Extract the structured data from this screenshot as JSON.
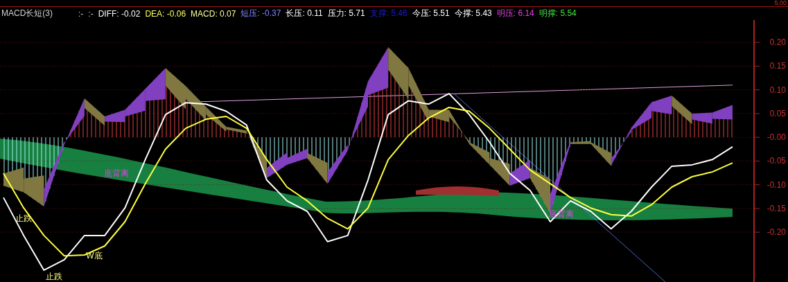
{
  "upper_panel": {
    "axis_label": "5.00"
  },
  "header": {
    "title": "MACD长短(3)",
    "markers": [
      ":-",
      ":-"
    ],
    "items": [
      {
        "label": "DIFF:",
        "value": "-0.02",
        "color": "#ffffff"
      },
      {
        "label": "DEA:",
        "value": "-0.06",
        "color": "#ffff66"
      },
      {
        "label": "MACD:",
        "value": "0.07",
        "color": "#ffffa0"
      },
      {
        "label": "短压:",
        "value": "-0.37",
        "color": "#8080ff"
      },
      {
        "label": "长压:",
        "value": "0.11",
        "color": "#ffffff"
      },
      {
        "label": "压力:",
        "value": "5.71",
        "color": "#ffffff"
      },
      {
        "label": "支撑:",
        "value": "5.46",
        "color": "#1c1cc8"
      },
      {
        "label": "今压:",
        "value": "5.51",
        "color": "#ffffff"
      },
      {
        "label": "今撑:",
        "value": "5.43",
        "color": "#ffffff"
      },
      {
        "label": "明压:",
        "value": "6.14",
        "color": "#e040e0"
      },
      {
        "label": "明撑:",
        "value": "5.54",
        "color": "#40e040"
      }
    ]
  },
  "chart_data": {
    "type": "line",
    "ylim": [
      -0.305,
      0.247
    ],
    "yticks": [
      {
        "value": 0.2,
        "label": "0.20"
      },
      {
        "value": 0.15,
        "label": "0.15"
      },
      {
        "value": 0.1,
        "label": "0.10"
      },
      {
        "value": 0.05,
        "label": "0.05"
      },
      {
        "value": 0,
        "label": "-0.00"
      },
      {
        "value": -0.05,
        "label": "-0.05"
      },
      {
        "value": -0.1,
        "label": "-0.10"
      },
      {
        "value": -0.15,
        "label": "-0.15"
      },
      {
        "value": -0.2,
        "label": "-0.20"
      }
    ],
    "series": [
      {
        "color": "#ffffff",
        "values": [
          -0.127,
          -0.207,
          -0.28,
          -0.258,
          -0.207,
          -0.207,
          -0.149,
          -0.047,
          0.048,
          0.073,
          0.07,
          0.055,
          0.026,
          -0.09,
          -0.134,
          -0.156,
          -0.22,
          -0.207,
          -0.09,
          0.048,
          0.077,
          0.07,
          0.092,
          0.048,
          -0.01,
          -0.076,
          -0.112,
          -0.178,
          -0.134,
          -0.156,
          -0.193,
          -0.156,
          -0.105,
          -0.061,
          -0.058,
          -0.047,
          -0.02
        ]
      },
      {
        "color": "#ffff40",
        "values": [
          -0.076,
          -0.149,
          -0.207,
          -0.25,
          -0.248,
          -0.229,
          -0.178,
          -0.098,
          -0.025,
          0.019,
          0.038,
          0.044,
          0.019,
          -0.047,
          -0.105,
          -0.134,
          -0.171,
          -0.193,
          -0.149,
          -0.047,
          0.004,
          0.041,
          0.063,
          0.055,
          0.019,
          -0.025,
          -0.069,
          -0.098,
          -0.127,
          -0.149,
          -0.163,
          -0.166,
          -0.142,
          -0.105,
          -0.083,
          -0.073,
          -0.054
        ]
      }
    ],
    "grid": true,
    "annotations": [
      "底背离",
      "底背离",
      "W底",
      "止跌",
      "止跌"
    ]
  }
}
